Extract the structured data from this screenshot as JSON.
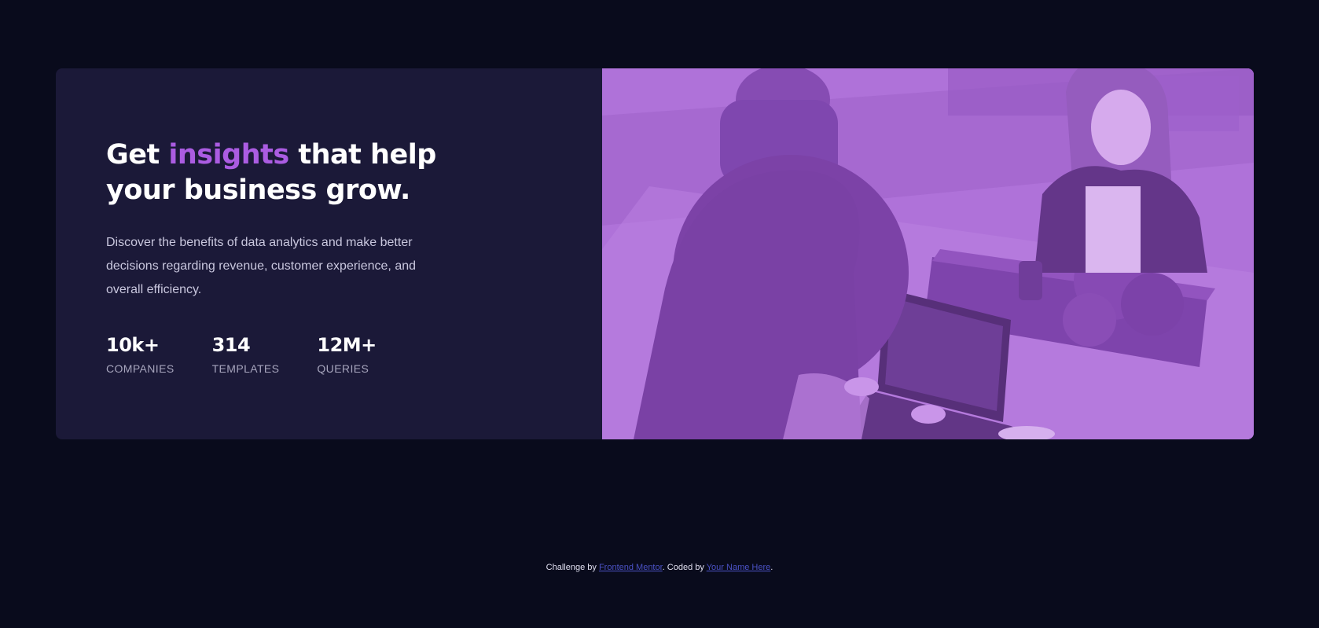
{
  "hero": {
    "headline_start": "Get ",
    "headline_accent": "insights",
    "headline_end": " that help your business grow.",
    "description": "Discover the benefits of data analytics and make better decisions regarding revenue, customer experience, and overall efficiency."
  },
  "stats": [
    {
      "value": "10k+",
      "label": "Companies"
    },
    {
      "value": "314",
      "label": "Templates"
    },
    {
      "value": "12M+",
      "label": "Queries"
    }
  ],
  "footer": {
    "prefix": "Challenge by ",
    "link1": "Frontend Mentor",
    "middle": ". Coded by ",
    "link2": "Your Name Here",
    "suffix": "."
  },
  "colors": {
    "background": "#090b1c",
    "card": "#1b1938",
    "accent": "#ab5ce2",
    "image_overlay": "#aa5cdb"
  },
  "image": {
    "description_icon": "team-working-photo"
  }
}
